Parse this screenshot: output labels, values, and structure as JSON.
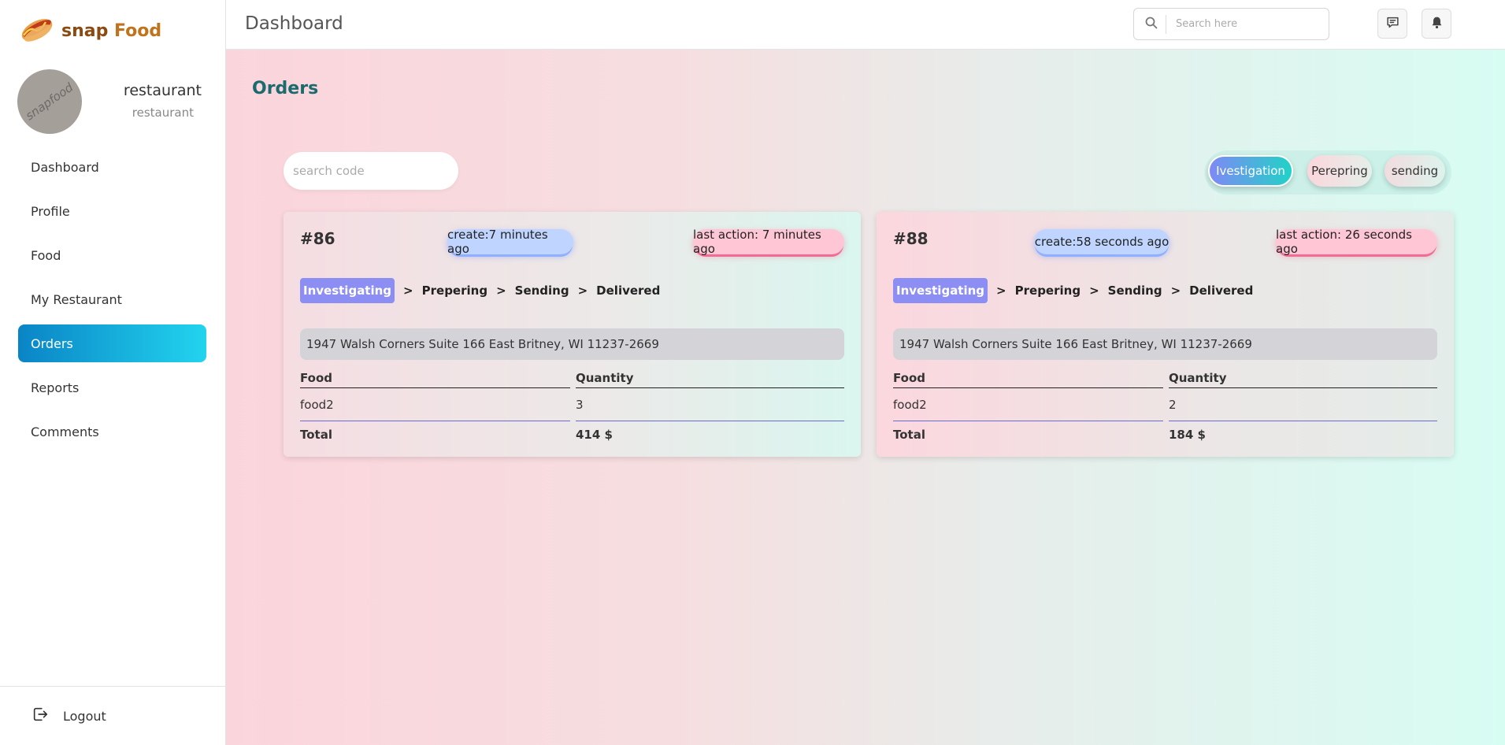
{
  "brand": {
    "name_part1": "snap",
    "name_part2": " Food",
    "logo_icon": "hotdog-icon"
  },
  "user": {
    "avatar_text": "snapfood",
    "name": "restaurant",
    "role": "restaurant"
  },
  "sidebar": {
    "items": [
      {
        "label": "Dashboard"
      },
      {
        "label": "Profile"
      },
      {
        "label": "Food"
      },
      {
        "label": "My Restaurant"
      },
      {
        "label": "Orders",
        "active": true
      },
      {
        "label": "Reports"
      },
      {
        "label": "Comments"
      }
    ],
    "logout_label": "Logout"
  },
  "header": {
    "title": "Dashboard",
    "search_placeholder": "Search here"
  },
  "page": {
    "title": "Orders",
    "code_search_placeholder": "search code",
    "filters": [
      {
        "label": "Ivestigation",
        "active": true
      },
      {
        "label": "Perepring"
      },
      {
        "label": "sending"
      }
    ]
  },
  "orders": [
    {
      "id": "#86",
      "created": "create:7 minutes ago",
      "last_action": "last action: 7 minutes ago",
      "steps": [
        "Investigating",
        "Prepering",
        "Sending",
        "Delivered"
      ],
      "separator": ">",
      "address": "1947 Walsh Corners Suite 166 East Britney, WI 11237-2669",
      "table": {
        "headers": [
          "Food",
          "Quantity"
        ],
        "rows": [
          {
            "food": "food2",
            "quantity": "3"
          }
        ],
        "total_label": "Total",
        "total_value": "414 $"
      }
    },
    {
      "id": "#88",
      "created": "create:58 seconds ago",
      "last_action": "last action: 26 seconds ago",
      "steps": [
        "Investigating",
        "Prepering",
        "Sending",
        "Delivered"
      ],
      "separator": ">",
      "address": "1947 Walsh Corners Suite 166 East Britney, WI 11237-2669",
      "table": {
        "headers": [
          "Food",
          "Quantity"
        ],
        "rows": [
          {
            "food": "food2",
            "quantity": "2"
          }
        ],
        "total_label": "Total",
        "total_value": "184 $"
      }
    }
  ],
  "colors": {
    "active_nav_start": "#0a84c6",
    "active_nav_end": "#22d4ee",
    "page_title": "#1a6b6e",
    "step_active": "#8c8ef3",
    "create_pill": "#bfd5ff",
    "action_pill": "#ffc7d6"
  }
}
